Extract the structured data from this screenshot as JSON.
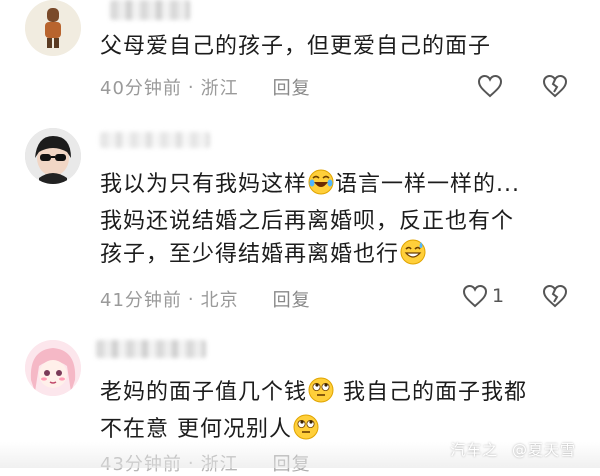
{
  "comments": [
    {
      "text": "父母爱自己的孩子，但更爱自己的面子",
      "time": "40分钟前",
      "location": "浙江",
      "reply_label": "回复",
      "likes": ""
    },
    {
      "text_line1_a": "我以为只有我妈这样",
      "text_line1_b": "语言一样一样的...",
      "text_line2": "我妈还说结婚之后再离婚呗，反正也有个",
      "text_line3": "孩子，至少得结婚再离婚也行",
      "time": "41分钟前",
      "location": "北京",
      "reply_label": "回复",
      "likes": "1"
    },
    {
      "text_line1_a": "老妈的面子值几个钱",
      "text_line1_b": "我自己的面子我都",
      "text_line2": "不在意 更何况别人",
      "time": "43分钟前",
      "location": "浙江",
      "reply_label": "回复",
      "likes": ""
    }
  ],
  "separator": "·",
  "watermark": {
    "logo": "汽车之",
    "author": "@夏天雪"
  },
  "icons": [
    "heart-icon",
    "broken-heart-icon",
    "laughing-emoji",
    "sweat-smile-emoji",
    "eye-roll-emoji"
  ]
}
